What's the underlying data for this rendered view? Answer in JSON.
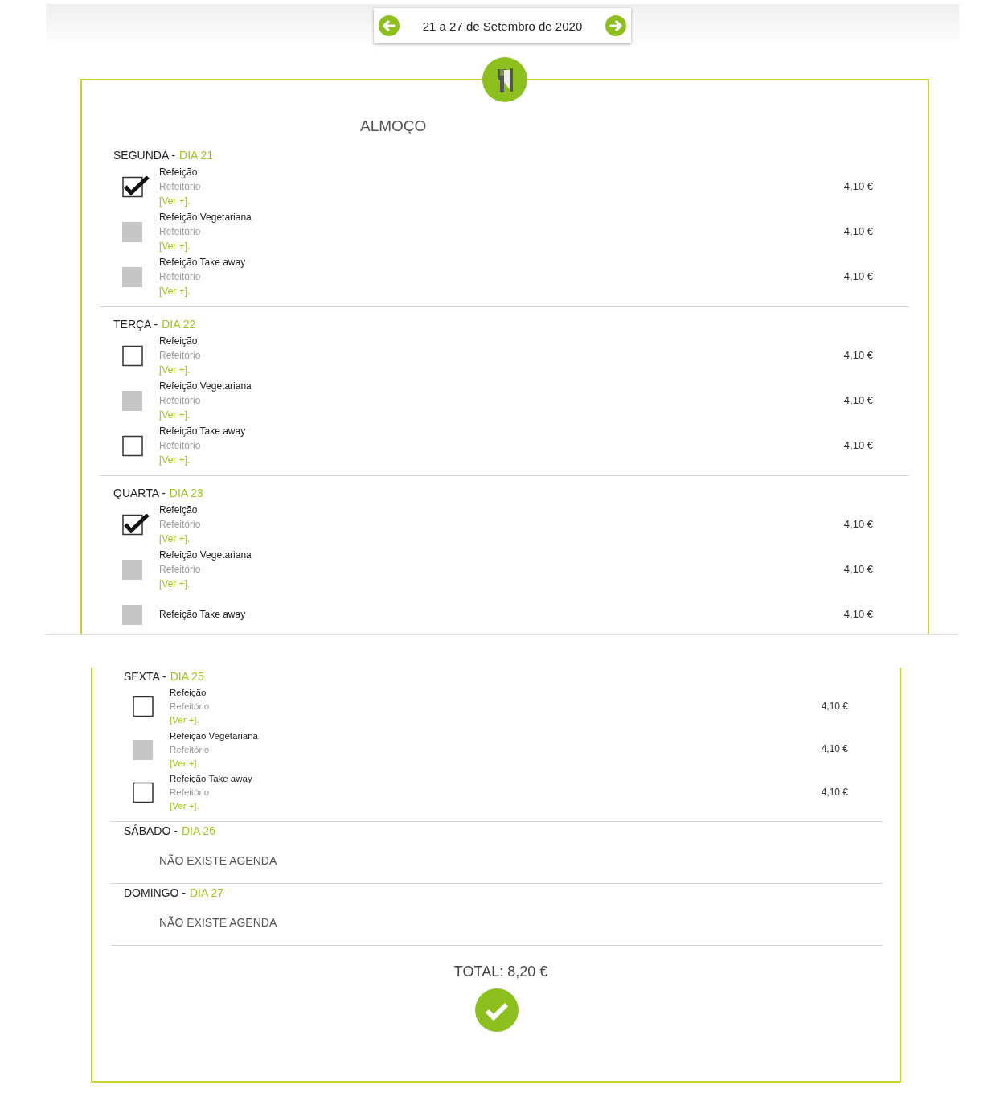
{
  "week_nav": {
    "label": "21 a 27 de Setembro de 2020"
  },
  "panels": [
    {
      "title": "ALMOÇO",
      "days": [
        {
          "weekday": "SEGUNDA -",
          "date": "DIA 21",
          "items": [
            {
              "name": "Refeição",
              "place": "Refeitório",
              "more": "[Ver +].",
              "price": "4,10 €",
              "checked": true,
              "disabled": false
            },
            {
              "name": "Refeição Vegetariana",
              "place": "Refeitório",
              "more": "[Ver +].",
              "price": "4,10 €",
              "checked": false,
              "disabled": true
            },
            {
              "name": "Refeição Take away",
              "place": "Refeitório",
              "more": "[Ver +].",
              "price": "4,10 €",
              "checked": false,
              "disabled": true
            }
          ]
        },
        {
          "weekday": "TERÇA -",
          "date": "DIA 22",
          "items": [
            {
              "name": "Refeição",
              "place": "Refeitório",
              "more": "[Ver +].",
              "price": "4,10 €",
              "checked": false,
              "disabled": false
            },
            {
              "name": "Refeição Vegetariana",
              "place": "Refeitório",
              "more": "[Ver +].",
              "price": "4,10 €",
              "checked": false,
              "disabled": true
            },
            {
              "name": "Refeição Take away",
              "place": "Refeitório",
              "more": "[Ver +].",
              "price": "4,10 €",
              "checked": false,
              "disabled": false
            }
          ]
        },
        {
          "weekday": "QUARTA -",
          "date": "DIA 23",
          "items": [
            {
              "name": "Refeição",
              "place": "Refeitório",
              "more": "[Ver +].",
              "price": "4,10 €",
              "checked": true,
              "disabled": false
            },
            {
              "name": "Refeição Vegetariana",
              "place": "Refeitório",
              "more": "[Ver +].",
              "price": "4,10 €",
              "checked": false,
              "disabled": true
            },
            {
              "name": "Refeição Take away",
              "price": "4,10 €",
              "checked": false,
              "disabled": true
            }
          ]
        }
      ]
    },
    {
      "days": [
        {
          "weekday": "SEXTA -",
          "date": "DIA 25",
          "items": [
            {
              "name": "Refeição",
              "place": "Refeitório",
              "more": "[Ver +].",
              "price": "4,10 €",
              "checked": false,
              "disabled": false
            },
            {
              "name": "Refeição Vegetariana",
              "place": "Refeitório",
              "more": "[Ver +].",
              "price": "4,10 €",
              "checked": false,
              "disabled": true
            },
            {
              "name": "Refeição Take away",
              "place": "Refeitório",
              "more": "[Ver +].",
              "price": "4,10 €",
              "checked": false,
              "disabled": false
            }
          ]
        },
        {
          "weekday": "SÁBADO -",
          "date": "DIA 26",
          "message": "NÃO EXISTE AGENDA"
        },
        {
          "weekday": "DOMINGO -",
          "date": "DIA 27",
          "message": "NÃO EXISTE AGENDA"
        }
      ],
      "total": "TOTAL: 8,20 €"
    }
  ]
}
